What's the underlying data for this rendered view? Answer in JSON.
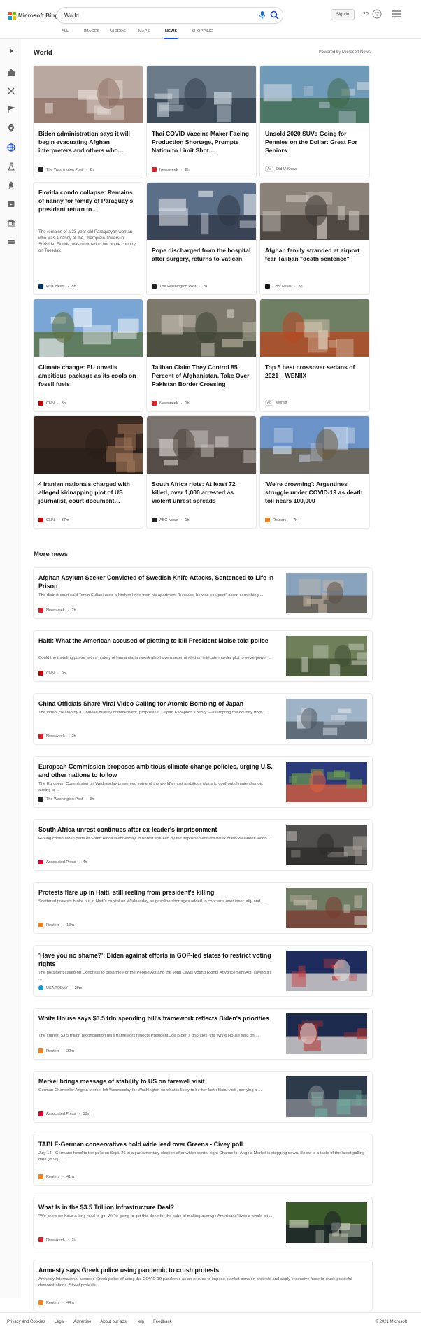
{
  "brand": {
    "logo_text": "Microsoft Bing",
    "colors": {
      "red": "#f25022",
      "green": "#7fba00",
      "blue": "#00a4ef",
      "yellow": "#ffb900",
      "accent": "#174ae4"
    }
  },
  "search": {
    "value": "World",
    "mic_icon": "microphone-icon",
    "search_icon": "search-icon"
  },
  "header": {
    "signin_label": "Sign in",
    "rewards_count": "20"
  },
  "tabs": [
    {
      "label": "ALL"
    },
    {
      "label": "IMAGES"
    },
    {
      "label": "VIDEOS"
    },
    {
      "label": "MAPS"
    },
    {
      "label": "NEWS",
      "active": true
    },
    {
      "label": "SHOPPING"
    }
  ],
  "sidebar": {
    "icons": [
      "expand-arrow-icon",
      "home-icon",
      "sports-icon",
      "flag-icon",
      "location-icon",
      "globe-icon",
      "science-icon",
      "rocket-icon",
      "entertainment-icon",
      "bank-icon",
      "money-icon"
    ]
  },
  "world": {
    "title": "World",
    "powered_by": "Powered by Microsoft News"
  },
  "cards": [
    {
      "title": "Biden administration says it will begin evacuating Afghan interpreters and others who…",
      "source": "The Washington Post",
      "age": "2h",
      "icon_color": "#222",
      "thumb": [
        "#b9a8a0",
        "#e7ddd6",
        "#8e6f63"
      ]
    },
    {
      "title": "Thai COVID Vaccine Maker Facing Production Shortage, Prompts Nation to Limit Shot…",
      "source": "Newsweek",
      "age": "2h",
      "icon_color": "#e01c24",
      "thumb": [
        "#6b7b8a",
        "#c9d3dc",
        "#2f3c4a"
      ]
    },
    {
      "title": "Unsold 2020 SUVs Going for Pennies on the Dollar: Great For Seniors",
      "source": "Did U Know",
      "ad": "Ad",
      "thumb": [
        "#6f9ab8",
        "#c4d1dc",
        "#3f6a4a"
      ]
    },
    {
      "title": "Florida condo collapse: Remains of nanny for family of Paraguay's president return to…",
      "snippet": "The remains of a 23-year-old Paraguayan woman who was a nanny at the Champlain Towers in Surfside, Florida, was returned to her home country on Tuesday.",
      "source": "FOX News",
      "age": "8h",
      "icon_color": "#003366"
    },
    {
      "title": "Pope discharged from the hospital after surgery, returns to Vatican",
      "source": "The Washington Post",
      "age": "2h",
      "icon_color": "#222",
      "thumb": [
        "#5c6f88",
        "#d6dbe2",
        "#2c3444"
      ]
    },
    {
      "title": "Afghan family stranded at airport fear Taliban \"death sentence\"",
      "source": "CBS News",
      "age": "3h",
      "icon_color": "#111",
      "thumb": [
        "#8a8178",
        "#d9d2c9",
        "#3b3531"
      ]
    },
    {
      "title": "Climate change: EU unveils ambitious package as its cools on fossil fuels",
      "source": "CNN",
      "age": "3h",
      "icon_color": "#cc0000",
      "thumb": [
        "#7aa6d6",
        "#e8eef4",
        "#5a6f3a"
      ]
    },
    {
      "title": "Taliban Claim They Control 85 Percent of Afghanistan, Take Over Pakistan Border Crossing",
      "source": "Newsweek",
      "age": "1h",
      "icon_color": "#e01c24",
      "thumb": [
        "#7d7a6c",
        "#c8c1b2",
        "#3e4331"
      ]
    },
    {
      "title": "Top 5 best crossover sedans of 2021 – WENIIX",
      "source": "weniix",
      "ad": "Ad",
      "thumb": [
        "#6f7f64",
        "#d9c9b4",
        "#b8461f"
      ]
    },
    {
      "title": "4 Iranian nationals charged with alleged kidnapping plot of US journalist, court document…",
      "source": "CNN",
      "age": "37m",
      "icon_color": "#cc0000",
      "thumb": [
        "#3b2a22",
        "#a67a5c",
        "#2a1f1a"
      ]
    },
    {
      "title": "South Africa riots: At least 72 killed, over 1,000 arrested as violent unrest spreads",
      "source": "ABC News",
      "age": "1h",
      "icon_color": "#222",
      "thumb": [
        "#7a7370",
        "#d2cbc7",
        "#4a3f3b"
      ]
    },
    {
      "title": "'We're drowning': Argentines struggle under COVID-19 as death toll nears 100,000",
      "source": "Reuters",
      "age": "7h",
      "icon_color": "#f58220",
      "thumb": [
        "#6c93c7",
        "#c9d9ea",
        "#6b5a3c"
      ]
    }
  ],
  "more_news": {
    "title": "More news",
    "items": [
      {
        "title": "Afghan Asylum Seeker Convicted of Swedish Knife Attacks, Sentenced to Life in Prison",
        "snippet": "The district court said Tamin Sultani used a kitchen knife from his apartment \"because he was so upset\" about something ...",
        "source": "Newsweek",
        "age": "2h",
        "icon_color": "#e01c24",
        "thumb": [
          "#8aa3bc",
          "#c9b8a3",
          "#5e5142"
        ]
      },
      {
        "title": "Haiti: What the American accused of plotting to kill President Moise told police",
        "snippet": "Could the traveling pastor with a history of humanitarian work also have masterminded an intricate murder plot to seize power ...",
        "source": "CNN",
        "age": "9h",
        "icon_color": "#cc0000",
        "thumb": [
          "#6e7f5a",
          "#c4c9b7",
          "#404f33"
        ]
      },
      {
        "title": "China Officials Share Viral Video Calling for Atomic Bombing of Japan",
        "snippet": "The video, created by a Chinese military commentator, proposes a \"Japan Exception Theory\"—exempting the country from ...",
        "source": "Newsweek",
        "age": "2h",
        "icon_color": "#e01c24",
        "thumb": [
          "#9fb3c6",
          "#dfe6ec",
          "#4a5560"
        ]
      },
      {
        "title": "European Commission proposes ambitious climate change policies, urging U.S. and other nations to follow",
        "snippet": "The European Commission on Wednesday presented some of the world's most ambitious plans to confront climate change, aiming to ...",
        "source": "The Washington Post",
        "age": "3h",
        "icon_color": "#222",
        "thumb": [
          "#2a3a7a",
          "#6ea04a",
          "#e0603a"
        ]
      },
      {
        "title": "South Africa unrest continues after ex-leader's imprisonment",
        "snippet": "Rioting continued in parts of South Africa Wednesday, in unrest sparked by the imprisonment last week of ex-President Jacob ...",
        "source": "Associated Press",
        "age": "4h",
        "icon_color": "#e4002b",
        "thumb": [
          "#4f4e4c",
          "#a9a39c",
          "#2b2a28"
        ]
      },
      {
        "title": "Protests flare up in Haiti, still reeling from president's killing",
        "snippet": "Scattered protests broke out in Haiti's capital on Wednesday as gasoline shortages added to concerns over insecurity and ...",
        "source": "Reuters",
        "age": "13m",
        "icon_color": "#f58220",
        "thumb": [
          "#6f7c63",
          "#bdb6a6",
          "#7a3a30"
        ]
      },
      {
        "title": "'Have you no shame?': Biden against efforts in GOP-led states to restrict voting rights",
        "snippet": "The president called on Congress to pass the For the People Act and the John Lewis Voting Rights Advancement Act, saying it's ...",
        "source": "USA TODAY",
        "age": "29m",
        "icon_color": "#009bde",
        "thumb": [
          "#1d2c5c",
          "#c93a3a",
          "#e8e1d9"
        ]
      },
      {
        "title": "White House says $3.5 trln spending bill's framework reflects Biden's priorities",
        "snippet": "The current $3.5 trillion reconciliation bill's framework reflects President Joe Biden's priorities, the White House said on ...",
        "source": "Reuters",
        "age": "22m",
        "icon_color": "#f58220",
        "thumb": [
          "#1c2a4e",
          "#b3312f",
          "#e7e2dc"
        ]
      },
      {
        "title": "Merkel brings message of stability to US on farewell visit",
        "snippet": "German Chancellor Angela Merkel left Wednesday for Washington on what is likely to be her last official visit , carrying a ...",
        "source": "Associated Press",
        "age": "58m",
        "icon_color": "#e4002b",
        "thumb": [
          "#2d3a4a",
          "#6fb0a0",
          "#8a8f96"
        ]
      },
      {
        "title": "TABLE-German conservatives hold wide lead over Greens - Civey poll",
        "snippet": "July 14 - Germans head to the polls on Sept. 26 in a parliamentary election after which center-right Chancellor Angela Merkel is stepping down. Below is a table of the latest polling data (in %): ...",
        "source": "Reuters",
        "age": "41m",
        "icon_color": "#f58220"
      },
      {
        "title": "What Is in the $3.5 Trillion Infrastructure Deal?",
        "snippet": "\"We know we have a long road to go. We're going to get this done for the sake of making average Americans' lives a whole lot ...",
        "source": "Newsweek",
        "age": "1h",
        "icon_color": "#e01c24",
        "thumb": [
          "#3b5a2a",
          "#c8cdb8",
          "#1a1f2a"
        ]
      },
      {
        "title": "Amnesty says Greek police using pandemic to crush protests",
        "snippet": "Amnesty International accused Greek police of using the COVID-19 pandemic as an excuse to impose blanket bans on protests and apply excessive force to crush peaceful demonstrations. Street protests ...",
        "source": "Reuters",
        "age": "44m",
        "icon_color": "#f58220"
      }
    ]
  },
  "footer": {
    "links": [
      "Privacy and Cookies",
      "Legal",
      "Advertise",
      "About our ads",
      "Help",
      "Feedback"
    ],
    "copyright": "© 2021 Microsoft"
  }
}
